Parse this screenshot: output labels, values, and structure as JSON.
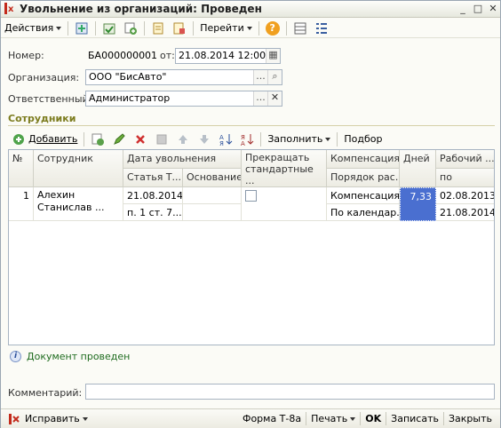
{
  "window": {
    "title": "Увольнение из организаций: Проведен",
    "btn_minimize": "_",
    "btn_maximize": "□",
    "btn_close": "✕"
  },
  "toolbar": {
    "actions_label": "Действия",
    "goto_label": "Перейти",
    "help_label": "?"
  },
  "form": {
    "number_label": "Номер:",
    "number_value": "БА000000001",
    "date_label": "от:",
    "date_value": "21.08.2014 12:00:00",
    "org_label": "Организация:",
    "org_value": "ООО \"БисАвто\"",
    "resp_label": "Ответственный:",
    "resp_value": "Администратор",
    "ellipsis": "...",
    "search_glyph": "⌕",
    "clear_glyph": "✕"
  },
  "employees": {
    "section_title": "Сотрудники",
    "add_label": "Добавить",
    "fill_label": "Заполнить",
    "select_label": "Подбор",
    "columns": {
      "num": "№",
      "employee": "Сотрудник",
      "dismissal_date": "Дата увольнения",
      "article": "Статья Т...",
      "basis": "Основание",
      "stop_standard": "Прекращать стандартные ...",
      "compensation": "Компенсация",
      "calc_order": "Порядок рас...",
      "days": "Дней",
      "work_period": "Рабочий ...",
      "to": "по"
    },
    "rows": [
      {
        "num": "1",
        "employee": "Алехин Станислав ...",
        "dismissal_date": "21.08.2014",
        "article": "п. 1 ст. 7...",
        "basis": "",
        "stop_standard": false,
        "compensation": "Компенсация",
        "calc_order": "По календар...",
        "days": "7,33",
        "work_from": "02.08.2013",
        "work_to": "21.08.2014"
      }
    ]
  },
  "status": {
    "posted_text": "Документ проведен"
  },
  "comment": {
    "label": "Комментарий:",
    "value": ""
  },
  "bottom": {
    "fix_label": "Исправить",
    "form_label": "Форма Т-8а",
    "print_label": "Печать",
    "ok_label": "OK",
    "save_label": "Записать",
    "close_label": "Закрыть"
  },
  "colors": {
    "accent_blue": "#4a6fd0",
    "section_title": "#7c7c1e",
    "status_green": "#1e6b1e"
  }
}
